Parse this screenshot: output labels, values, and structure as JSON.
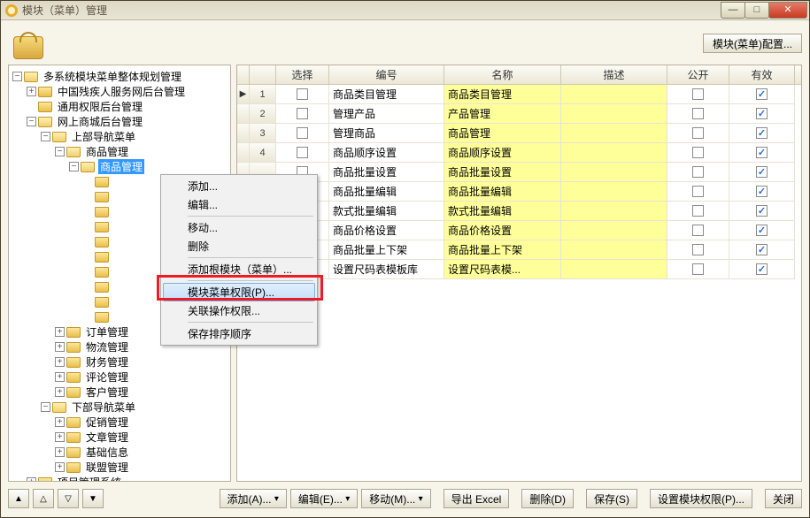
{
  "window": {
    "title": "模块（菜单）管理"
  },
  "toolbar": {
    "config_btn": "模块(菜单)配置..."
  },
  "tree": {
    "root": "多系统模块菜单整体规划管理",
    "n1": "中国残疾人服务网后台管理",
    "n2": "通用权限后台管理",
    "n3": "网上商城后台管理",
    "n3_1": "上部导航菜单",
    "n3_1_1": "商品管理",
    "n3_1_1_sel": "商品管理",
    "n3_1_2": "订单管理",
    "n3_1_3": "物流管理",
    "n3_1_4": "财务管理",
    "n3_1_5": "评论管理",
    "n3_1_6": "客户管理",
    "n3_2": "下部导航菜单",
    "n3_2_1": "促销管理",
    "n3_2_2": "文章管理",
    "n3_2_3": "基础信息",
    "n3_2_4": "联盟管理",
    "n4": "项目管理系统"
  },
  "grid": {
    "headers": {
      "ptr": "",
      "num": "",
      "select": "选择",
      "code": "编号",
      "name": "名称",
      "desc": "描述",
      "pub": "公开",
      "eff": "有效"
    },
    "rows": [
      {
        "num": "1",
        "ptr": "▶",
        "sel": false,
        "code": "商品类目管理",
        "name": "商品类目管理",
        "desc": "",
        "pub": false,
        "eff": true
      },
      {
        "num": "2",
        "ptr": "",
        "sel": false,
        "code": "管理产品",
        "name": "产品管理",
        "desc": "",
        "pub": false,
        "eff": true
      },
      {
        "num": "3",
        "ptr": "",
        "sel": false,
        "code": "管理商品",
        "name": "商品管理",
        "desc": "",
        "pub": false,
        "eff": true
      },
      {
        "num": "4",
        "ptr": "",
        "sel": false,
        "code": "商品顺序设置",
        "name": "商品顺序设置",
        "desc": "",
        "pub": false,
        "eff": true
      },
      {
        "num": "",
        "ptr": "",
        "sel": false,
        "code": "商品批量设置",
        "name": "商品批量设置",
        "desc": "",
        "pub": false,
        "eff": true
      },
      {
        "num": "",
        "ptr": "",
        "sel": false,
        "code": "商品批量编辑",
        "name": "商品批量编辑",
        "desc": "",
        "pub": false,
        "eff": true
      },
      {
        "num": "",
        "ptr": "",
        "sel": false,
        "code": "款式批量编辑",
        "name": "款式批量编辑",
        "desc": "",
        "pub": false,
        "eff": true
      },
      {
        "num": "",
        "ptr": "",
        "sel": false,
        "code": "商品价格设置",
        "name": "商品价格设置",
        "desc": "",
        "pub": false,
        "eff": true
      },
      {
        "num": "",
        "ptr": "",
        "sel": false,
        "code": "商品批量上下架",
        "name": "商品批量上下架",
        "desc": "",
        "pub": false,
        "eff": true
      },
      {
        "num": "",
        "ptr": "",
        "sel": false,
        "code": "设置尺码表模板库",
        "name": "设置尺码表模...",
        "desc": "",
        "pub": false,
        "eff": true
      }
    ]
  },
  "context_menu": {
    "add": "添加...",
    "edit": "编辑...",
    "move": "移动...",
    "delete": "删除",
    "add_root": "添加根模块（菜单）...",
    "perm": "模块菜单权限(P)...",
    "rel_perm": "关联操作权限...",
    "save_order": "保存排序顺序"
  },
  "footer": {
    "add": "添加(A)...",
    "edit": "编辑(E)...",
    "move": "移动(M)...",
    "export": "导出 Excel",
    "delete": "删除(D)",
    "save": "保存(S)",
    "set_perm": "设置模块权限(P)...",
    "close": "关闭"
  }
}
